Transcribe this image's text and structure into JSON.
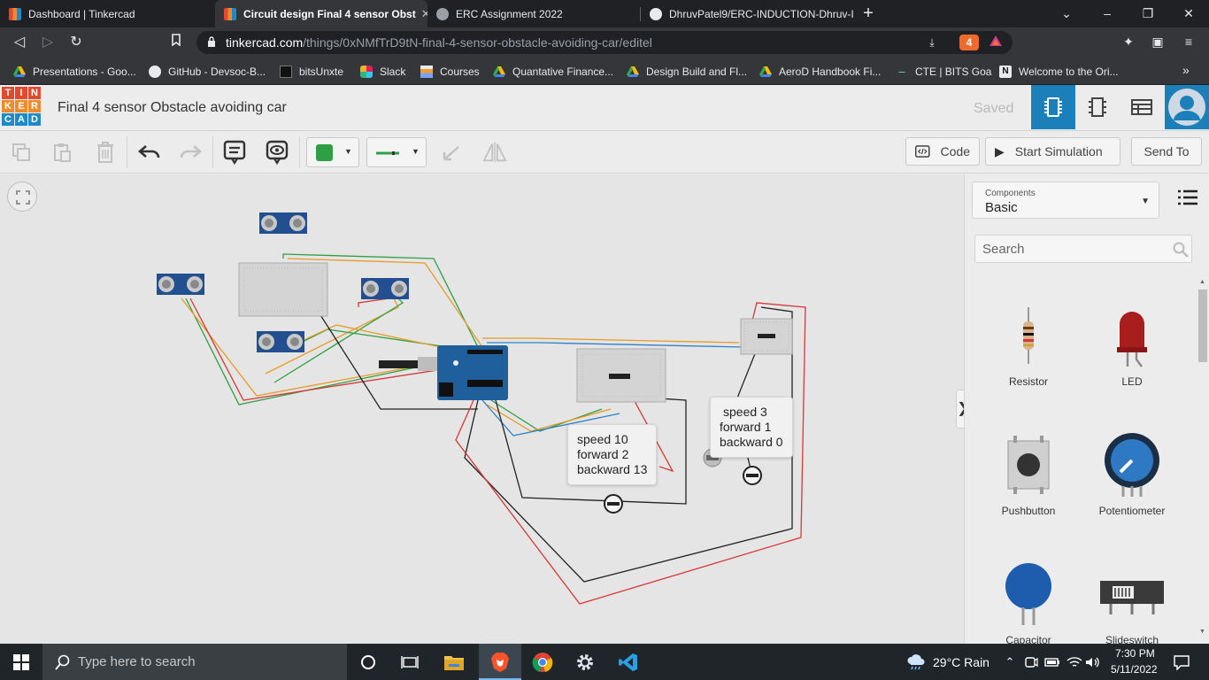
{
  "browser": {
    "tabs": [
      {
        "title": "Dashboard | Tinkercad",
        "active": false
      },
      {
        "title": "Circuit design Final 4 sensor Obst",
        "active": true
      },
      {
        "title": "ERC Assignment 2022",
        "active": false
      },
      {
        "title": "DhruvPatel9/ERC-INDUCTION-Dhruv-I",
        "active": false
      }
    ],
    "url_host": "tinkercad.com",
    "url_path": "/things/0xNMfTrD9tN-final-4-sensor-obstacle-avoiding-car/editel",
    "extension_badge": "4",
    "bookmarks": [
      "Presentations - Goo...",
      "GitHub - Devsoc-B...",
      "bitsUnxte",
      "Slack",
      "Courses",
      "Quantative Finance...",
      "Design Build and Fl...",
      "AeroD Handbook Fi...",
      "CTE | BITS Goa",
      "Welcome to the Ori..."
    ]
  },
  "tinkercad": {
    "logo_letters": [
      "T",
      "I",
      "N",
      "K",
      "E",
      "R",
      "C",
      "A",
      "D"
    ],
    "logo_colors": [
      "#e2492f",
      "#e2492f",
      "#e2492f",
      "#f08b2c",
      "#f08b2c",
      "#f08b2c",
      "#1f8ac9",
      "#1f8ac9",
      "#1f8ac9"
    ],
    "title": "Final 4 sensor Obstacle avoiding car",
    "saved": "Saved",
    "toolbar": {
      "fill_color": "#2ea043",
      "code_label": "Code",
      "simulate_label": "Start Simulation",
      "send_label": "Send To"
    },
    "bubbles": [
      {
        "lines": [
          "speed 10",
          "forward 2",
          "backward 13"
        ]
      },
      {
        "lines": [
          "speed 3",
          "forward 1",
          "backward 0"
        ]
      }
    ],
    "panel": {
      "select_label": "Components",
      "select_value": "Basic",
      "search_placeholder": "Search",
      "components": [
        "Resistor",
        "LED",
        "Pushbutton",
        "Potentiometer",
        "Capacitor",
        "Slideswitch"
      ]
    }
  },
  "taskbar": {
    "search_placeholder": "Type here to search",
    "weather": "29°C  Rain",
    "time": "7:30 PM",
    "date": "5/11/2022"
  }
}
